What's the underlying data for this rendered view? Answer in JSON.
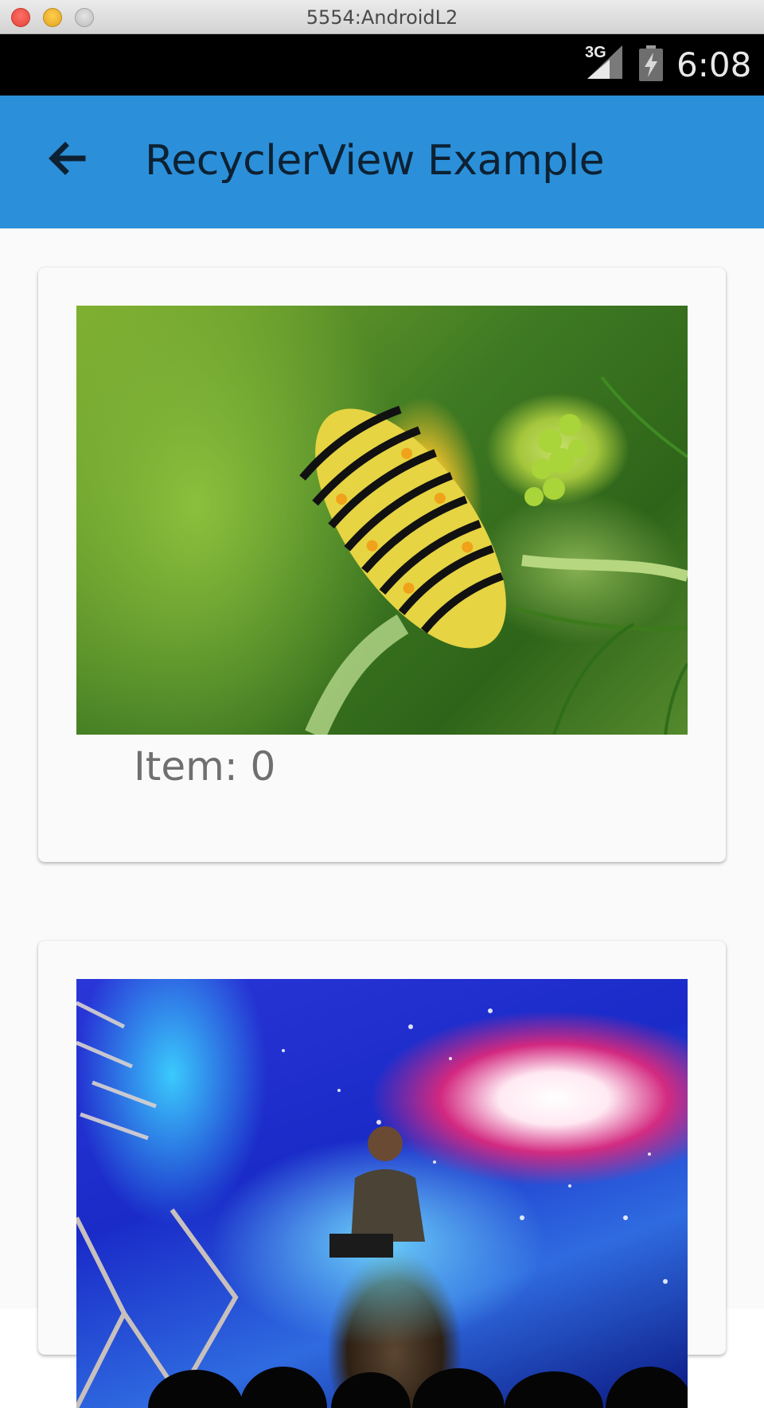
{
  "window": {
    "title": "5554:AndroidL2"
  },
  "status_bar": {
    "network": "3G",
    "time": "6:08",
    "signal_icon": "cell-signal-icon",
    "battery_icon": "battery-charging-icon"
  },
  "app_bar": {
    "title": "RecyclerView Example",
    "back_icon": "arrow-back-icon",
    "color": "#2b90d9"
  },
  "cards": [
    {
      "image": "caterpillar-photo",
      "label": "Item: 0"
    },
    {
      "image": "galaxy-stage-photo",
      "label": ""
    }
  ]
}
